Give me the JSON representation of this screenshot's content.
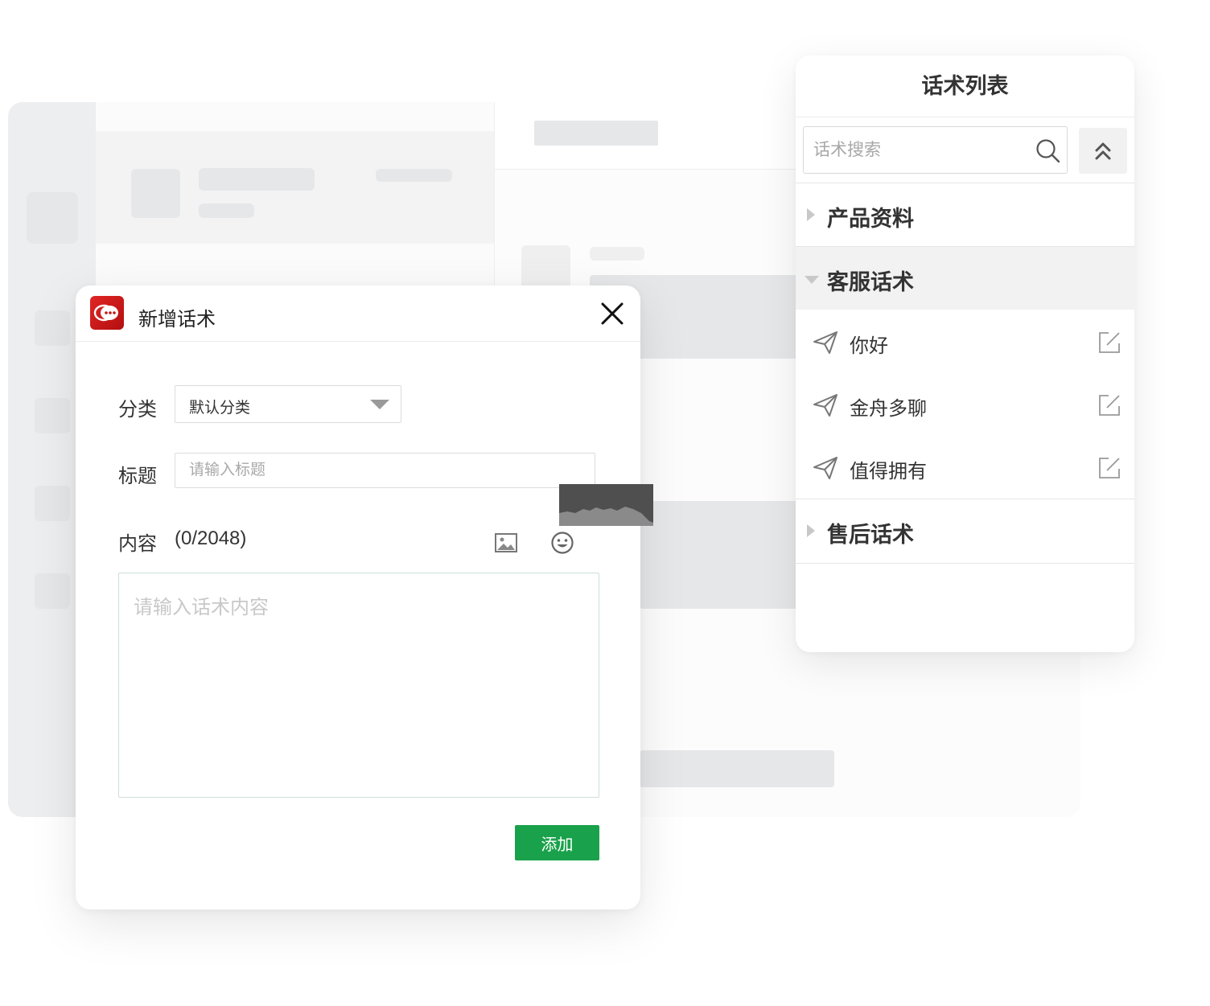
{
  "dialog": {
    "title": "新增话术",
    "category_label": "分类",
    "category_value": "默认分类",
    "title_label": "标题",
    "title_placeholder": "请输入标题",
    "content_label": "内容",
    "content_count": "(0/2048)",
    "content_placeholder": "请输入话术内容",
    "add_button": "添加"
  },
  "panel": {
    "title": "话术列表",
    "search_placeholder": "话术搜索",
    "categories": [
      {
        "label": "产品资料",
        "expanded": false
      },
      {
        "label": "客服话术",
        "expanded": true,
        "items": [
          "你好",
          "金舟多聊",
          "值得拥有"
        ]
      },
      {
        "label": "售后话术",
        "expanded": false
      }
    ]
  },
  "colors": {
    "accent_green": "#1aa14b",
    "logo_red": "#d41e1e",
    "active_row": "#f2f2f2"
  },
  "icons": [
    "app-logo-icon",
    "close-icon",
    "chevron-down-icon",
    "image-icon",
    "emoji-icon",
    "search-icon",
    "collapse-up-icon",
    "send-icon",
    "edit-icon"
  ]
}
